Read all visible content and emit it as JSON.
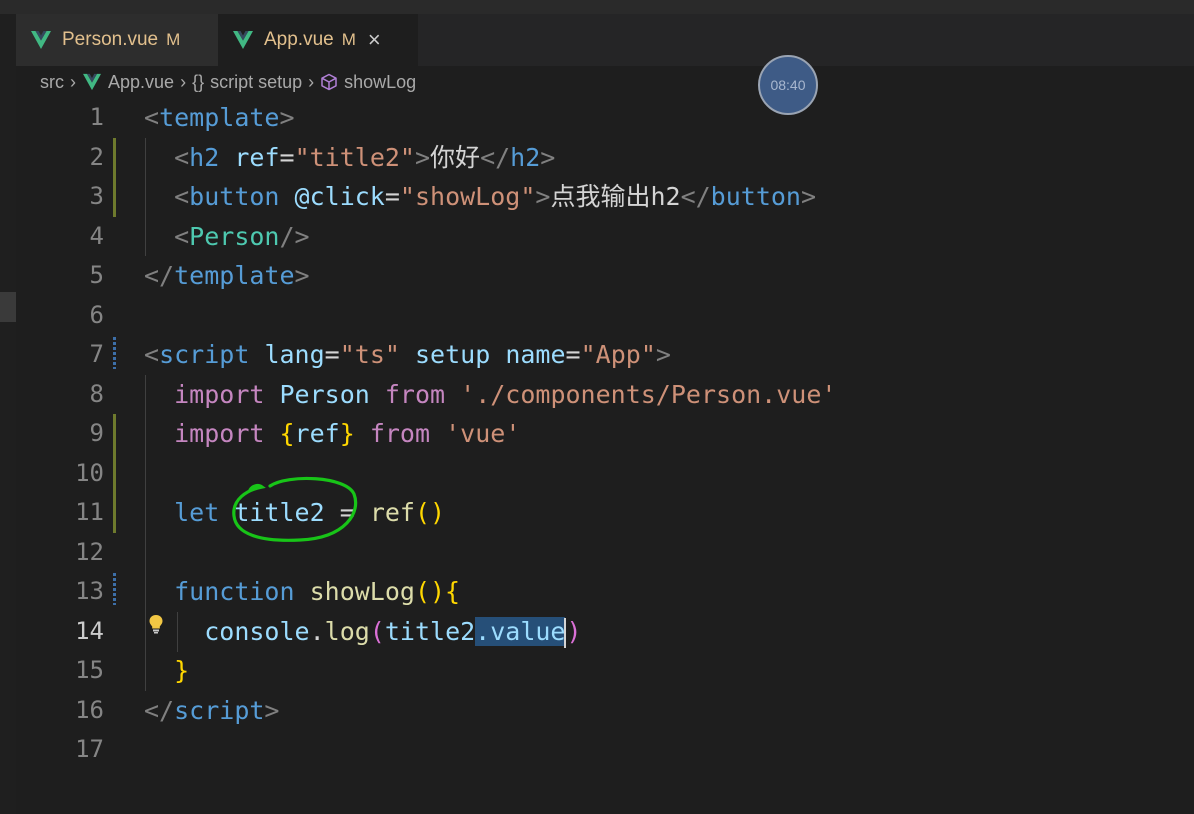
{
  "tabs": [
    {
      "name": "Person.vue",
      "status": "M",
      "active": false
    },
    {
      "name": "App.vue",
      "status": "M",
      "active": true,
      "close": "×"
    }
  ],
  "breadcrumb": {
    "root": "src",
    "file": "App.vue",
    "block": "script setup",
    "block_icon": "{}",
    "symbol": "showLog"
  },
  "timer": {
    "text": "08:40"
  },
  "editor": {
    "current_line": 14,
    "line_numbers": [
      "1",
      "2",
      "3",
      "4",
      "5",
      "6",
      "7",
      "8",
      "9",
      "10",
      "11",
      "12",
      "13",
      "14",
      "15",
      "16",
      "17"
    ],
    "lines": [
      [
        [
          "punc",
          "<"
        ],
        [
          "tag",
          "template"
        ],
        [
          "punc",
          ">"
        ]
      ],
      [
        [
          "text",
          "  "
        ],
        [
          "punc",
          "<"
        ],
        [
          "tag",
          "h2"
        ],
        [
          "text",
          " "
        ],
        [
          "attr",
          "ref"
        ],
        [
          "eq",
          "="
        ],
        [
          "str",
          "\"title2\""
        ],
        [
          "punc",
          ">"
        ],
        [
          "text",
          "你好"
        ],
        [
          "punc",
          "</"
        ],
        [
          "tag",
          "h2"
        ],
        [
          "punc",
          ">"
        ]
      ],
      [
        [
          "text",
          "  "
        ],
        [
          "punc",
          "<"
        ],
        [
          "tag",
          "button"
        ],
        [
          "text",
          " "
        ],
        [
          "attr",
          "@click"
        ],
        [
          "eq",
          "="
        ],
        [
          "str",
          "\"showLog\""
        ],
        [
          "punc",
          ">"
        ],
        [
          "text",
          "点我输出h2"
        ],
        [
          "punc",
          "</"
        ],
        [
          "tag",
          "button"
        ],
        [
          "punc",
          ">"
        ]
      ],
      [
        [
          "text",
          "  "
        ],
        [
          "punc",
          "<"
        ],
        [
          "comp",
          "Person"
        ],
        [
          "punc",
          "/>"
        ]
      ],
      [
        [
          "punc",
          "</"
        ],
        [
          "tag",
          "template"
        ],
        [
          "punc",
          ">"
        ]
      ],
      [],
      [
        [
          "punc",
          "<"
        ],
        [
          "tag",
          "script"
        ],
        [
          "text",
          " "
        ],
        [
          "attr",
          "lang"
        ],
        [
          "eq",
          "="
        ],
        [
          "str",
          "\"ts\""
        ],
        [
          "text",
          " "
        ],
        [
          "attr",
          "setup"
        ],
        [
          "text",
          " "
        ],
        [
          "attr",
          "name"
        ],
        [
          "eq",
          "="
        ],
        [
          "str",
          "\"App\""
        ],
        [
          "punc",
          ">"
        ]
      ],
      [
        [
          "text",
          "  "
        ],
        [
          "kw",
          "import"
        ],
        [
          "text",
          " "
        ],
        [
          "var",
          "Person"
        ],
        [
          "text",
          " "
        ],
        [
          "kw",
          "from"
        ],
        [
          "text",
          " "
        ],
        [
          "str",
          "'./components/Person.vue'"
        ]
      ],
      [
        [
          "text",
          "  "
        ],
        [
          "kw",
          "import"
        ],
        [
          "text",
          " "
        ],
        [
          "brace",
          "{"
        ],
        [
          "var",
          "ref"
        ],
        [
          "brace",
          "}"
        ],
        [
          "text",
          " "
        ],
        [
          "kw",
          "from"
        ],
        [
          "text",
          " "
        ],
        [
          "str",
          "'vue'"
        ]
      ],
      [],
      [
        [
          "text",
          "  "
        ],
        [
          "decl",
          "let"
        ],
        [
          "text",
          " "
        ],
        [
          "var",
          "title2"
        ],
        [
          "text",
          " "
        ],
        [
          "id",
          "="
        ],
        [
          "text",
          " "
        ],
        [
          "fn",
          "ref"
        ],
        [
          "brace",
          "()"
        ]
      ],
      [],
      [
        [
          "text",
          "  "
        ],
        [
          "decl",
          "function"
        ],
        [
          "text",
          " "
        ],
        [
          "fn",
          "showLog"
        ],
        [
          "brace",
          "(){"
        ]
      ],
      [
        [
          "text",
          "    "
        ],
        [
          "var",
          "console"
        ],
        [
          "id",
          "."
        ],
        [
          "fn",
          "log"
        ],
        [
          "brace2",
          "("
        ],
        [
          "var",
          "title2"
        ],
        [
          "sel",
          ".value"
        ],
        [
          "cursor",
          ""
        ],
        [
          "brace2",
          ")"
        ]
      ],
      [
        [
          "text",
          "  "
        ],
        [
          "brace",
          "}"
        ]
      ],
      [
        [
          "punc",
          "</"
        ],
        [
          "tag",
          "script"
        ],
        [
          "punc",
          ">"
        ]
      ],
      []
    ]
  },
  "colors": {
    "background": "#1e1e1e",
    "modified_tab_text": "#e2c08d",
    "annotation_circle": "#18c418",
    "vue_logo": "#41b883"
  }
}
